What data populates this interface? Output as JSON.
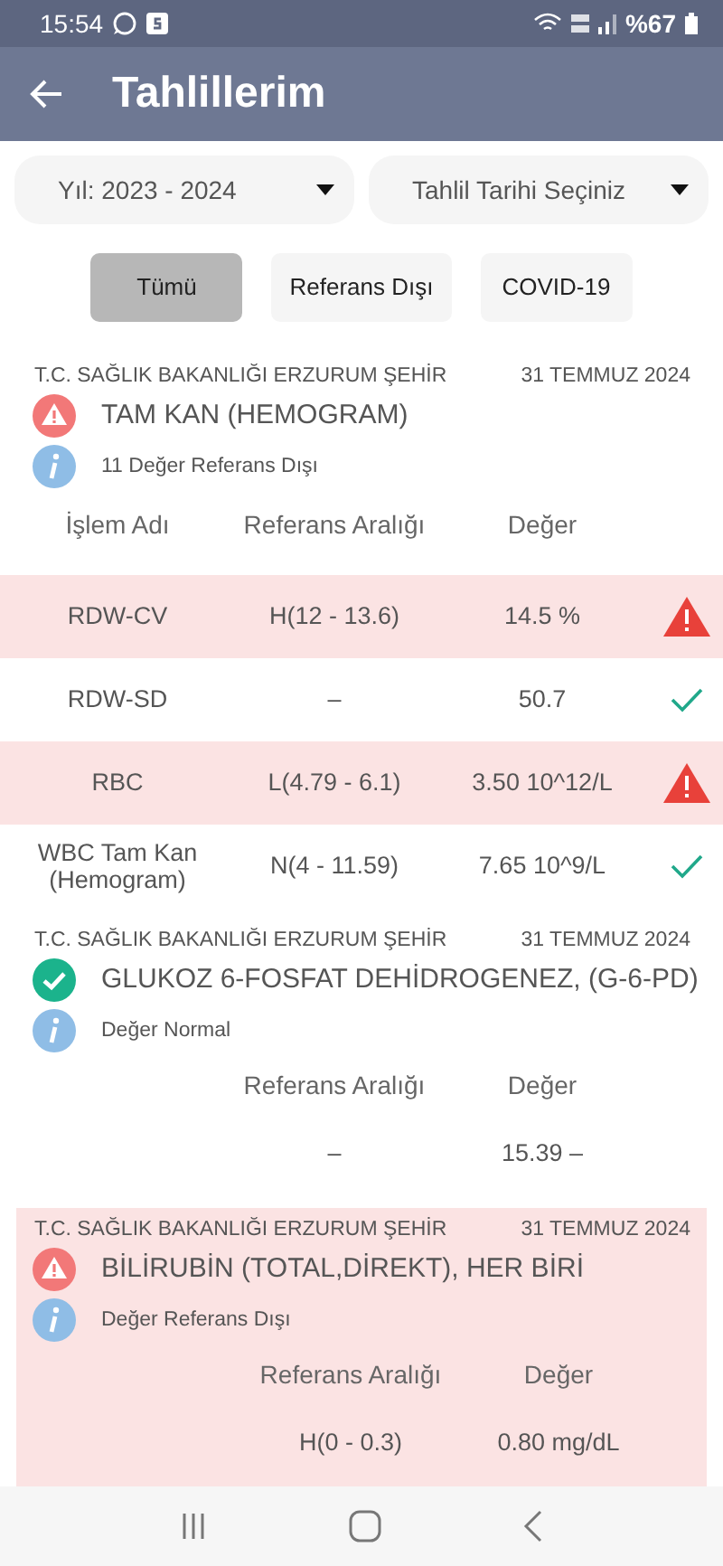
{
  "status_bar": {
    "time": "15:54",
    "battery": "%67"
  },
  "app_bar": {
    "title": "Tahlillerim"
  },
  "dropdowns": [
    {
      "label": "Yıl: 2023 - 2024"
    },
    {
      "label": "Tahlil Tarihi Seçiniz"
    }
  ],
  "filters": [
    {
      "label": "Tümü",
      "selected": true
    },
    {
      "label": "Referans Dışı",
      "selected": false
    },
    {
      "label": "COVID-19",
      "selected": false
    }
  ],
  "results": [
    {
      "hospital": "T.C. SAĞLIK BAKANLIĞI ERZURUM ŞEHİR",
      "date": "31 TEMMUZ 2024",
      "title": "TAM KAN (HEMOGRAM)",
      "kind": "abnormal",
      "info": "11 Değer Referans Dışı",
      "highlighted": false,
      "headers": {
        "name": "İşlem Adı",
        "range": "Referans Aralığı",
        "value": "Değer"
      },
      "rows": [
        {
          "name": "RDW-CV",
          "range": "H(12 - 13.6)",
          "value": "14.5 %",
          "kind": "warning"
        },
        {
          "name": "RDW-SD",
          "range": "–",
          "value": "50.7",
          "kind": "ok"
        },
        {
          "name": "RBC",
          "range": "L(4.79 - 6.1)",
          "value": "3.50 10^12/L",
          "kind": "warning"
        },
        {
          "name": "WBC  Tam Kan (Hemogram)",
          "range": "N(4 - 11.59)",
          "value": "7.65 10^9/L",
          "kind": "ok"
        }
      ]
    },
    {
      "hospital": "T.C. SAĞLIK BAKANLIĞI ERZURUM ŞEHİR",
      "date": "31 TEMMUZ 2024",
      "title": "GLUKOZ 6-FOSFAT DEHİDROGENEZ, (G-6-PD)",
      "kind": "normal",
      "info": "Değer Normal",
      "highlighted": false,
      "headers": {
        "range": "Referans Aralığı",
        "value": "Değer"
      },
      "rows": [
        {
          "range": "–",
          "value": "15.39 –"
        }
      ]
    },
    {
      "hospital": "T.C. SAĞLIK BAKANLIĞI ERZURUM ŞEHİR",
      "date": "31 TEMMUZ 2024",
      "title": "BİLİRUBİN (TOTAL,DİREKT), HER BİRİ",
      "kind": "abnormal",
      "info": "Değer Referans Dışı",
      "highlighted": true,
      "headers": {
        "range": "Referans Aralığı",
        "value": "Değer"
      },
      "rows": [
        {
          "range": "H(0 - 0.3)",
          "value": "0.80 mg/dL"
        }
      ]
    }
  ]
}
